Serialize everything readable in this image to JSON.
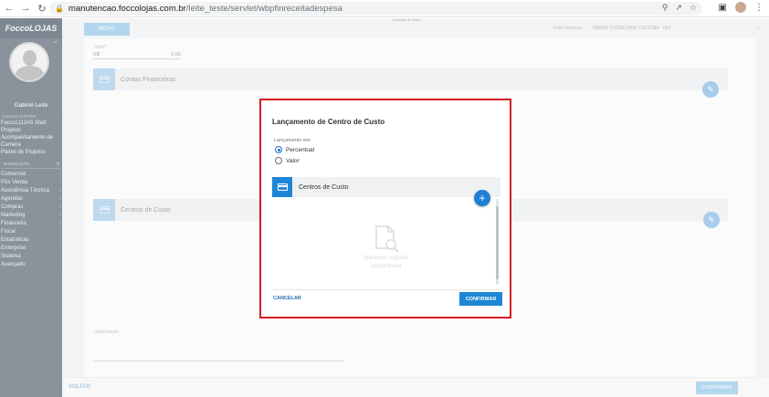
{
  "browser": {
    "url_host": "manutencao.foccolojas.com.br",
    "url_path": "/leite_teste/servlet/wbpfinreceitadespesa",
    "icons": [
      "back-arrow-icon",
      "forward-arrow-icon",
      "reload-icon",
      "lock-icon",
      "zoom-icon",
      "share-icon",
      "star-icon",
      "sidepanel-icon",
      "profile-avatar",
      "kebab-menu-icon"
    ]
  },
  "sidebar": {
    "logo": "FoccoLOJAS",
    "user_name": "Gabriel Leite",
    "access_section": "ACESSO RÁPIDO",
    "quick_links": [
      "FoccoLOJAS Start",
      "Projetos",
      "Acompanhamento de Carreira",
      "Painel de Projetos"
    ],
    "nav_label": "NAVEGAÇÃO",
    "menu": [
      "Comercial",
      "Pós Venda",
      "Assistência Técnica",
      "Agendas",
      "Compras",
      "Marketing",
      "Financeiro",
      "Fiscal",
      "Estatísticas",
      "Enterprise",
      "Sistema",
      "Avançado"
    ]
  },
  "page": {
    "env_text": "Ambiente de Testes",
    "novo_label": "NOVO",
    "topbar_company_label": "Fale Conosco",
    "topbar_user": "000006 TOOKESHINI CUCCINA - 024",
    "valor_label": "Valor*",
    "valor_currency": "R$",
    "valor_value": "0,00",
    "section_contas": "Contas Financeiras",
    "section_centros": "Centros de Custo",
    "observacao_label": "Observação",
    "voltar_label": "VOLTAR",
    "confirmar_label": "CONFIRMAR"
  },
  "modal": {
    "title": "Lançamento de Centro de Custo",
    "lancamento_label": "Lançamento em:",
    "options": [
      {
        "label": "Percentual",
        "selected": true
      },
      {
        "label": "Valor",
        "selected": false
      }
    ],
    "panel_title": "Centros de Custo",
    "add_icon": "plus-icon",
    "empty_text_1": "Nenhum registro",
    "empty_text_2": "encontrado",
    "cancel_label": "CANCELAR",
    "confirm_label": "CONFIRMAR"
  },
  "colors": {
    "highlight_border": "#d21b23",
    "primary": "#1f86d6",
    "sidebar_bg": "#8a929c"
  }
}
